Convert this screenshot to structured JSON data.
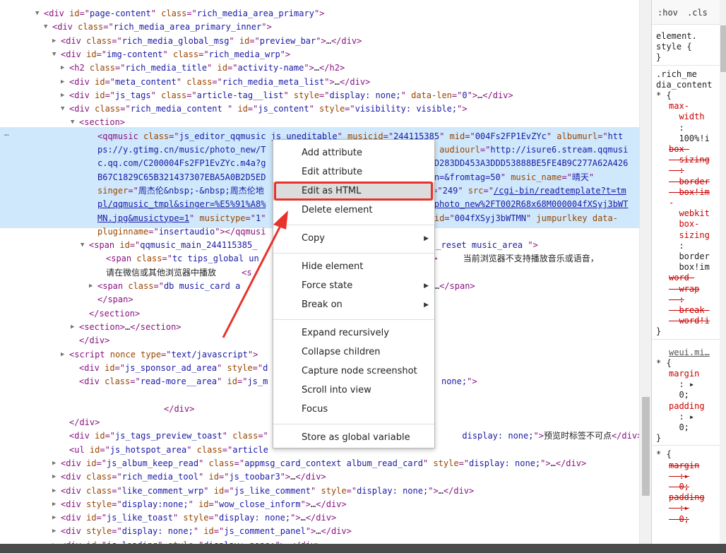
{
  "elements_panel": {
    "lines": [
      {
        "indent": 62,
        "tri": "▼",
        "html": "<span class=\"tag\">&lt;div </span><span class=\"attr\">id</span><span class=\"tag\">=\"</span><span class=\"val\">page-content</span><span class=\"tag\">\" </span><span class=\"attr\">class</span><span class=\"tag\">=\"</span><span class=\"val\">rich_media_area_primary</span><span class=\"tag\">\"&gt;</span>"
      },
      {
        "indent": 74,
        "tri": "▼",
        "html": "<span class=\"tag\">&lt;div </span><span class=\"attr\">class</span><span class=\"tag\">=\"</span><span class=\"val\">rich_media_area_primary_inner</span><span class=\"tag\">\"&gt;</span>"
      },
      {
        "indent": 86,
        "tri": "▶",
        "html": "<span class=\"tag\">&lt;div </span><span class=\"attr\">class</span><span class=\"tag\">=\"</span><span class=\"val\">rich_media_global_msg</span><span class=\"tag\">\" </span><span class=\"attr\">id</span><span class=\"tag\">=\"</span><span class=\"val\">preview_bar</span><span class=\"tag\">\"&gt;</span><span class=\"txt\">…</span><span class=\"tag\">&lt;/div&gt;</span>"
      },
      {
        "indent": 86,
        "tri": "▼",
        "html": "<span class=\"tag\">&lt;div </span><span class=\"attr\">id</span><span class=\"tag\">=\"</span><span class=\"val\">img-content</span><span class=\"tag\">\" </span><span class=\"attr\">class</span><span class=\"tag\">=\"</span><span class=\"val\">rich_media_wrp</span><span class=\"tag\">\"&gt;</span>"
      },
      {
        "indent": 98,
        "tri": "▶",
        "html": "<span class=\"tag\">&lt;h2 </span><span class=\"attr\">class</span><span class=\"tag\">=\"</span><span class=\"val\">rich_media_title</span><span class=\"tag\">\" </span><span class=\"attr\">id</span><span class=\"tag\">=\"</span><span class=\"val\">activity-name</span><span class=\"tag\">\"&gt;</span><span class=\"txt\">…</span><span class=\"tag\">&lt;/h2&gt;</span>"
      },
      {
        "indent": 98,
        "tri": "▶",
        "html": "<span class=\"tag\">&lt;div </span><span class=\"attr\">id</span><span class=\"tag\">=\"</span><span class=\"val\">meta_content</span><span class=\"tag\">\" </span><span class=\"attr\">class</span><span class=\"tag\">=\"</span><span class=\"val\">rich_media_meta_list</span><span class=\"tag\">\"&gt;</span><span class=\"txt\">…</span><span class=\"tag\">&lt;/div&gt;</span>"
      },
      {
        "indent": 98,
        "tri": "▶",
        "html": "<span class=\"tag\">&lt;div </span><span class=\"attr\">id</span><span class=\"tag\">=\"</span><span class=\"val\">js_tags</span><span class=\"tag\">\" </span><span class=\"attr\">class</span><span class=\"tag\">=\"</span><span class=\"val\">article-tag__list</span><span class=\"tag\">\" </span><span class=\"attr\">style</span><span class=\"tag\">=\"</span><span class=\"val\">display: none;</span><span class=\"tag\">\" </span><span class=\"attr\">data-len</span><span class=\"tag\">=\"</span><span class=\"val\">0</span><span class=\"tag\">\"&gt;</span><span class=\"txt\">…</span><span class=\"tag\">&lt;/div&gt;</span>"
      },
      {
        "indent": 98,
        "tri": "▼",
        "html": "<span class=\"tag\">&lt;div </span><span class=\"attr\">class</span><span class=\"tag\">=\"</span><span class=\"val\">rich_media_content </span><span class=\"tag\">\" </span><span class=\"attr\">id</span><span class=\"tag\">=\"</span><span class=\"val\">js_content</span><span class=\"tag\">\" </span><span class=\"attr\">style</span><span class=\"tag\">=\"</span><span class=\"val\">visibility: visible;</span><span class=\"tag\">\"&gt;</span>"
      },
      {
        "indent": 112,
        "tri": "▼",
        "html": "<span class=\"tag\">&lt;section&gt;</span>"
      },
      {
        "indent": 138,
        "tri": "",
        "hl": true,
        "html": "<span class=\"tag\">&lt;qqmusic </span><span class=\"attr\">class</span><span class=\"tag\">=\"</span><span class=\"val\">js_editor_qqmusic js_uneditable</span><span class=\"tag\">\" </span><span class=\"attr\">musicid</span><span class=\"tag\">=\"</span><span class=\"val\">244115385</span><span class=\"tag\">\" </span><span class=\"attr\">mid</span><span class=\"tag\">=\"</span><span class=\"val\">004Fs2FP1EvZYc</span><span class=\"tag\">\" </span><span class=\"attr\">albumurl</span><span class=\"tag\">=\"</span><span class=\"val\">htt</span>"
      },
      {
        "indent": 138,
        "tri": "",
        "hl": true,
        "html": "<span class=\"val\">ps://y.gtimg.cn/music/photo_new/T                                </span><span class=\"tag\">\" </span><span class=\"attr\">audiourl</span><span class=\"tag\">=\"</span><span class=\"val\">http://isure6.stream.qqmusi</span>"
      },
      {
        "indent": 138,
        "tri": "",
        "hl": true,
        "html": "<span class=\"val\">c.qq.com/C200004Fs2FP1EvZYc.m4a?g                                4D283DD453A3DDD53888BE5FE4B9C277A62A426</span>"
      },
      {
        "indent": 138,
        "tri": "",
        "hl": true,
        "html": "<span class=\"val\">B67C1829C65B321437307EBA5A0B2D5ED                                in=&amp;fromtag=50</span><span class=\"tag\">\" </span><span class=\"attr\">music_name</span><span class=\"tag\">=\"</span><span class=\"val cjk\">晴天</span><span class=\"tag\">\"</span>"
      },
      {
        "indent": 138,
        "tri": "",
        "hl": true,
        "html": "<span class=\"attr\">singer</span><span class=\"tag\">=\"</span><span class=\"val cjk\">周杰伦</span><span class=\"val\">&amp;nbsp;-&amp;nbsp;</span><span class=\"val cjk\">周杰伦地</span><span class=\"val\">                                </span><span class=\"tag\">n=\"</span><span class=\"val\">249</span><span class=\"tag\">\" </span><span class=\"attr\">src</span><span class=\"tag\">=\"</span><span class=\"link\">/cgi-bin/readtemplate?t=tm</span>"
      },
      {
        "indent": 138,
        "tri": "",
        "hl": true,
        "html": "<span class=\"link\">pl/qqmusic_tmpl&amp;singer=%E5%91%A8%</span><span class=\"val\">                                </span><span class=\"link\">Fphoto_new%2FT002R68x68M000004fXSyj3bWT</span>"
      },
      {
        "indent": 138,
        "tri": "",
        "hl": true,
        "html": "<span class=\"link\">MN.jpg&amp;musictype=1</span><span class=\"tag\">\" </span><span class=\"attr\">musictype</span><span class=\"tag\">=\"</span><span class=\"val\">1</span><span class=\"tag\">\"</span><span class=\"val\">                                 </span><span class=\"attr\">id</span><span class=\"tag\">=\"</span><span class=\"val\">004fXSyj3bWTMN</span><span class=\"tag\">\" </span><span class=\"attr\">jumpurlkey data-</span>"
      },
      {
        "indent": 138,
        "tri": "",
        "hl": true,
        "html": "<span class=\"attr\">pluginname</span><span class=\"tag\">=\"</span><span class=\"val\">insertaudio</span><span class=\"tag\">\"&gt;&lt;/qqmusi</span>"
      },
      {
        "indent": 126,
        "tri": "▼",
        "html": "<span class=\"tag\">&lt;span </span><span class=\"attr\">id</span><span class=\"tag\">=\"</span><span class=\"val\">qqmusic_main_244115385_</span><span class=\"val\">                                 es_reset music_area </span><span class=\"tag\">\"&gt;</span>"
      },
      {
        "indent": 150,
        "tri": "",
        "html": "<span class=\"tag\">&lt;span </span><span class=\"attr\">class</span><span class=\"tag\">=\"</span><span class=\"val\">tc tips_global un</span><span class=\"val\">                                </span><span class=\"tag\">;\"&gt;</span><span class=\"txt\">     </span><span class=\"txt cjk\">当前浏览器不支持播放音乐或语音，</span>"
      },
      {
        "indent": 150,
        "tri": "",
        "html": "<span class=\"txt cjk\">请在微信或其他浏览器中播放</span><span class=\"txt\">     </span><span class=\"tag\">&lt;s</span>"
      },
      {
        "indent": 138,
        "tri": "▶",
        "html": "<span class=\"tag\">&lt;span </span><span class=\"attr\">class</span><span class=\"tag\">=\"</span><span class=\"val\">db music_card a</span><span class=\"val\">                                 </span><span class=\"val\">ive</span><span class=\"tag\">\"&gt;</span><span class=\"txt\">…</span><span class=\"tag\">&lt;/span&gt;</span>"
      },
      {
        "indent": 138,
        "tri": "",
        "html": "<span class=\"tag\">&lt;/span&gt;</span>"
      },
      {
        "indent": 126,
        "tri": "",
        "html": "<span class=\"tag\">&lt;/section&gt;</span>"
      },
      {
        "indent": 112,
        "tri": "▶",
        "html": "<span class=\"tag\">&lt;section&gt;</span><span class=\"txt\">…</span><span class=\"tag\">&lt;/section&gt;</span>"
      },
      {
        "indent": 112,
        "tri": "",
        "html": "<span class=\"tag\">&lt;/div&gt;</span>"
      },
      {
        "indent": 98,
        "tri": "▶",
        "html": "<span class=\"tag\">&lt;script </span><span class=\"attr\">nonce type</span><span class=\"tag\">=\"</span><span class=\"val\">text/javascript</span><span class=\"tag\">\"&gt;</span>"
      },
      {
        "indent": 112,
        "tri": "",
        "html": "<span class=\"tag\">&lt;div </span><span class=\"attr\">id</span><span class=\"tag\">=\"</span><span class=\"val\">js_sponsor_ad_area</span><span class=\"tag\">\" </span><span class=\"attr\">style</span><span class=\"tag\">=\"</span><span class=\"val\">d</span>"
      },
      {
        "indent": 112,
        "tri": "",
        "html": "<span class=\"tag\">&lt;div </span><span class=\"attr\">class</span><span class=\"tag\">=\"</span><span class=\"val\">read-more__area</span><span class=\"tag\">\" </span><span class=\"attr\">id</span><span class=\"tag\">=\"</span><span class=\"val\">js_m</span><span class=\"val\">                                  none;</span><span class=\"tag\">\"&gt;</span>"
      },
      {
        "indent": 98,
        "tri": "",
        "html": " "
      },
      {
        "indent": 232,
        "tri": "",
        "html": "<span class=\"tag\">&lt;/div&gt;</span>"
      },
      {
        "indent": 98,
        "tri": "",
        "html": "<span class=\"tag\">&lt;/div&gt;</span>"
      },
      {
        "indent": 98,
        "tri": "",
        "html": "<span class=\"tag\">&lt;div </span><span class=\"attr\">id</span><span class=\"tag\">=\"</span><span class=\"val\">js_tags_preview_toast</span><span class=\"tag\">\" </span><span class=\"attr\">class</span><span class=\"tag\">=\"</span><span class=\"val\">                                      </span><span class=\"val\">display: none;</span><span class=\"tag\">\"&gt;</span><span class=\"txt cjk\">预览时标签不可点</span><span class=\"tag\">&lt;/div&gt;</span>"
      },
      {
        "indent": 98,
        "tri": "",
        "html": "<span class=\"tag\">&lt;ul </span><span class=\"attr\">id</span><span class=\"tag\">=\"</span><span class=\"val\">js_hotspot_area</span><span class=\"tag\">\" </span><span class=\"attr\">class</span><span class=\"tag\">=\"</span><span class=\"val\">article</span>"
      },
      {
        "indent": 86,
        "tri": "▶",
        "html": "<span class=\"tag\">&lt;div </span><span class=\"attr\">id</span><span class=\"tag\">=\"</span><span class=\"val\">js_album_keep_read</span><span class=\"tag\">\" </span><span class=\"attr\">class</span><span class=\"tag\">=\"</span><span class=\"val\">appmsg_card_context album_read_card</span><span class=\"tag\">\" </span><span class=\"attr\">style</span><span class=\"tag\">=\"</span><span class=\"val\">display: none;</span><span class=\"tag\">\"&gt;</span><span class=\"txt\">…</span><span class=\"tag\">&lt;/div&gt;</span>"
      },
      {
        "indent": 86,
        "tri": "▶",
        "html": "<span class=\"tag\">&lt;div </span><span class=\"attr\">class</span><span class=\"tag\">=\"</span><span class=\"val\">rich_media_tool</span><span class=\"tag\">\" </span><span class=\"attr\">id</span><span class=\"tag\">=\"</span><span class=\"val\">js_toobar3</span><span class=\"tag\">\"&gt;</span><span class=\"txt\">…</span><span class=\"tag\">&lt;/div&gt;</span>"
      },
      {
        "indent": 86,
        "tri": "▶",
        "html": "<span class=\"tag\">&lt;div </span><span class=\"attr\">class</span><span class=\"tag\">=\"</span><span class=\"val\">like_comment_wrp</span><span class=\"tag\">\" </span><span class=\"attr\">id</span><span class=\"tag\">=\"</span><span class=\"val\">js_like_comment</span><span class=\"tag\">\" </span><span class=\"attr\">style</span><span class=\"tag\">=\"</span><span class=\"val\">display: none;</span><span class=\"tag\">\"&gt;</span><span class=\"txt\">…</span><span class=\"tag\">&lt;/div&gt;</span>"
      },
      {
        "indent": 86,
        "tri": "▶",
        "html": "<span class=\"tag\">&lt;div </span><span class=\"attr\">style</span><span class=\"tag\">=\"</span><span class=\"val\">display:none;</span><span class=\"tag\">\" </span><span class=\"attr\">id</span><span class=\"tag\">=\"</span><span class=\"val\">wow_close_inform</span><span class=\"tag\">\"&gt;</span><span class=\"txt\">…</span><span class=\"tag\">&lt;/div&gt;</span>"
      },
      {
        "indent": 86,
        "tri": "▶",
        "html": "<span class=\"tag\">&lt;div </span><span class=\"attr\">id</span><span class=\"tag\">=\"</span><span class=\"val\">js_like_toast</span><span class=\"tag\">\" </span><span class=\"attr\">style</span><span class=\"tag\">=\"</span><span class=\"val\">display: none;</span><span class=\"tag\">\"&gt;</span><span class=\"txt\">…</span><span class=\"tag\">&lt;/div&gt;</span>"
      },
      {
        "indent": 86,
        "tri": "▶",
        "html": "<span class=\"tag\">&lt;div </span><span class=\"attr\">style</span><span class=\"tag\">=\"</span><span class=\"val\">display: none;</span><span class=\"tag\">\" </span><span class=\"attr\">id</span><span class=\"tag\">=\"</span><span class=\"val\">js_comment_panel</span><span class=\"tag\">\"&gt;</span><span class=\"txt\">…</span><span class=\"tag\">&lt;/div&gt;</span>"
      },
      {
        "indent": 86,
        "tri": "▶",
        "html": "<span class=\"tag\">&lt;div </span><span class=\"attr\">id</span><span class=\"tag\">=\"</span><span class=\"val\">js_loading</span><span class=\"tag\">\" </span><span class=\"attr\">style</span><span class=\"tag\">=\"</span><span class=\"val\">display: none;</span><span class=\"tag\">\"&gt;</span><span class=\"txt\">…</span><span class=\"tag\">&lt;/div&gt;</span>"
      }
    ],
    "ellipsis_marker": "…"
  },
  "styles_panel": {
    "toolbar": {
      "hov": ":hov",
      "cls": ".cls"
    },
    "element_style": {
      "selector_line1": "element.",
      "selector_line2": "style {",
      "close": "}"
    },
    "rule1": {
      "selector": [
        ".rich_me",
        "dia_content",
        "* {"
      ],
      "lines": [
        {
          "cls": "prop",
          "text": "max-"
        },
        {
          "cls": "prop",
          "text": "  width"
        },
        {
          "cls": "pval",
          "text": "  :"
        },
        {
          "cls": "pval",
          "text": "  100%!i"
        },
        {
          "cls": "strike",
          "text": "box-"
        },
        {
          "cls": "strike",
          "text": "  sizing"
        },
        {
          "cls": "strike",
          "text": "  :"
        },
        {
          "cls": "strike",
          "text": "  border"
        },
        {
          "cls": "strike",
          "text": "  box!im"
        },
        {
          "cls": "prop",
          "text": "-"
        },
        {
          "cls": "prop",
          "text": "  webkit"
        },
        {
          "cls": "prop",
          "text": "  box-"
        },
        {
          "cls": "prop",
          "text": "  sizing"
        },
        {
          "cls": "pval",
          "text": "  :"
        },
        {
          "cls": "pval",
          "text": "  border"
        },
        {
          "cls": "pval",
          "text": "  box!im"
        },
        {
          "cls": "strike",
          "text": "word-"
        },
        {
          "cls": "strike",
          "text": "  wrap"
        },
        {
          "cls": "strike",
          "text": "  :"
        },
        {
          "cls": "strike",
          "text": "  break-"
        },
        {
          "cls": "strike",
          "text": "  word!i"
        }
      ],
      "close": "}"
    },
    "rule2": {
      "origin": "weui.mi…",
      "selector": "* {",
      "lines": [
        {
          "cls": "prop",
          "text": "margin"
        },
        {
          "cls": "pval",
          "text": "  : ▸"
        },
        {
          "cls": "pval",
          "text": "  0;"
        },
        {
          "cls": "prop",
          "text": "padding"
        },
        {
          "cls": "pval",
          "text": "  : ▸"
        },
        {
          "cls": "pval",
          "text": "  0;"
        }
      ],
      "close": "}"
    },
    "rule3": {
      "selector": "* {",
      "lines": [
        {
          "cls": "strike",
          "text": "margin"
        },
        {
          "cls": "strike",
          "text": "  :▸"
        },
        {
          "cls": "strike",
          "text": "  0;"
        },
        {
          "cls": "strike",
          "text": "padding"
        },
        {
          "cls": "strike",
          "text": "  :▸"
        },
        {
          "cls": "strike",
          "text": "  0;"
        }
      ]
    }
  },
  "context_menu": {
    "items": [
      {
        "label": "Add attribute",
        "submenu": false
      },
      {
        "label": "Edit attribute",
        "submenu": false
      },
      {
        "label": "Edit as HTML",
        "submenu": false,
        "active": true
      },
      {
        "label": "Delete element",
        "submenu": false
      },
      {
        "sep": true
      },
      {
        "label": "Copy",
        "submenu": true
      },
      {
        "sep": true
      },
      {
        "label": "Hide element",
        "submenu": false
      },
      {
        "label": "Force state",
        "submenu": true
      },
      {
        "label": "Break on",
        "submenu": true
      },
      {
        "sep": true
      },
      {
        "label": "Expand recursively",
        "submenu": false
      },
      {
        "label": "Collapse children",
        "submenu": false
      },
      {
        "label": "Capture node screenshot",
        "submenu": false
      },
      {
        "label": "Scroll into view",
        "submenu": false
      },
      {
        "label": "Focus",
        "submenu": false
      },
      {
        "sep": true
      },
      {
        "label": "Store as global variable",
        "submenu": false
      }
    ]
  },
  "colors": {
    "selection_highlight": "#cfe8fc",
    "annotation_red": "#e8322b",
    "tag": "#881280",
    "attribute": "#994500",
    "value": "#1a1aa6"
  }
}
